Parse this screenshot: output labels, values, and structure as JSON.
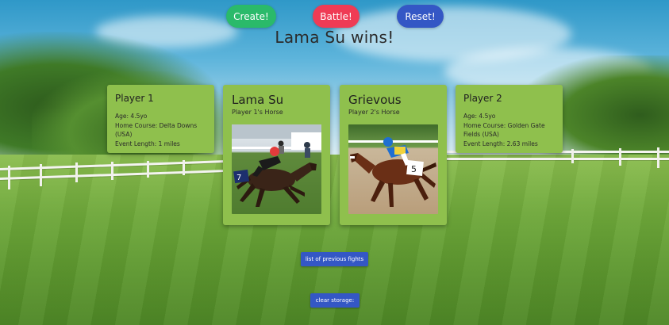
{
  "controls": {
    "create_label": "Create!",
    "battle_label": "Battle!",
    "reset_label": "Reset!"
  },
  "result": {
    "text": "Lama Su wins!"
  },
  "players": [
    {
      "title": "Player 1",
      "age": "Age: 4.5yo",
      "home_course": "Home Course: Delta Downs (USA)",
      "event_length": "Event Length: 1 miles"
    },
    {
      "title": "Player 2",
      "age": "Age: 4.5yo",
      "home_course": "Home Course: Golden Gate Fields (USA)",
      "event_length": "Event Length: 2.63 miles"
    }
  ],
  "horses": [
    {
      "name": "Lama Su",
      "subtitle": "Player 1's Horse",
      "saddle_number": "7"
    },
    {
      "name": "Grievous",
      "subtitle": "Player 2's Horse",
      "saddle_number": "5"
    }
  ],
  "footer": {
    "history_label": "list of previous fights",
    "clear_label": "clear storage:"
  },
  "colors": {
    "card": "#8fc04d",
    "create": "#2aba6a",
    "battle": "#ef3b55",
    "reset": "#3457c5"
  }
}
